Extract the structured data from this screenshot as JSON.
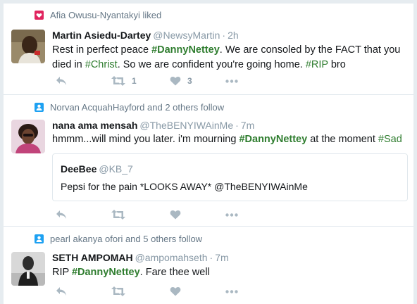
{
  "tweets": [
    {
      "context": "Afia Owusu-Nyantakyi liked",
      "context_icon": "heart-badge-icon",
      "name": "Martin Asiedu-Dartey",
      "handle": "@NewsyMartin",
      "dot": "·",
      "time": "2h",
      "text": {
        "p1": "Rest in perfect peace ",
        "tag1": "#DannyNettey",
        "p2": ". We are consoled by the FACT that you",
        "p3": "died in ",
        "tag2": "#Christ",
        "p4": ". So we are confident you're going home. ",
        "tag3": "#RIP",
        "p5": " bro"
      },
      "retweets": "1",
      "likes": "3"
    },
    {
      "context": "Norvan AcquahHayford and 2 others follow",
      "context_icon": "person-badge-icon",
      "name": "nana ama mensah",
      "handle": "@TheBENYIWAinMe",
      "dot": "·",
      "time": "7m",
      "text": {
        "p1": "hmmm...will mind you later. i'm mourning ",
        "tag1": "#DannyNettey",
        "p2": " at the moment ",
        "tag2": "#Sad"
      },
      "quote": {
        "name": "DeeBee",
        "handle": "@KB_7",
        "text": "Pepsi for the pain *LOOKS AWAY* @TheBENYIWAinMe"
      }
    },
    {
      "context": "pearl akanya ofori and 5 others follow",
      "context_icon": "person-badge-icon",
      "name": "SETH AMPOMAH",
      "handle": "@ampomahseth",
      "dot": "·",
      "time": "7m",
      "text": {
        "p1": "RIP ",
        "tag1": "#DannyNettey",
        "p2": ". Fare thee well"
      }
    }
  ],
  "colors": {
    "hashtag": "#2f7d2f",
    "like_badge": "#e0245e",
    "follow_badge": "#1da1f2",
    "action_icon": "#aab8c2"
  }
}
